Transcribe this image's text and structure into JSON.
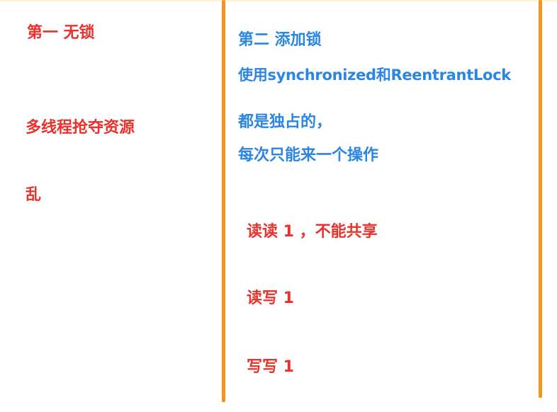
{
  "colors": {
    "red_text": "#e8322c",
    "blue_text": "#2a86e0",
    "divider": "#f7941d"
  },
  "left_column": {
    "title": "第一 无锁",
    "point1": "多线程抢夺资源",
    "point2": "乱"
  },
  "right_column": {
    "title": "第二 添加锁",
    "subtitle": "使用synchronized和ReentrantLock",
    "desc_line1": "都是独占的，",
    "desc_line2": "每次只能来一个操作",
    "cases": [
      "读读  1 ，不能共享",
      "读写  1",
      "写写  1"
    ]
  }
}
